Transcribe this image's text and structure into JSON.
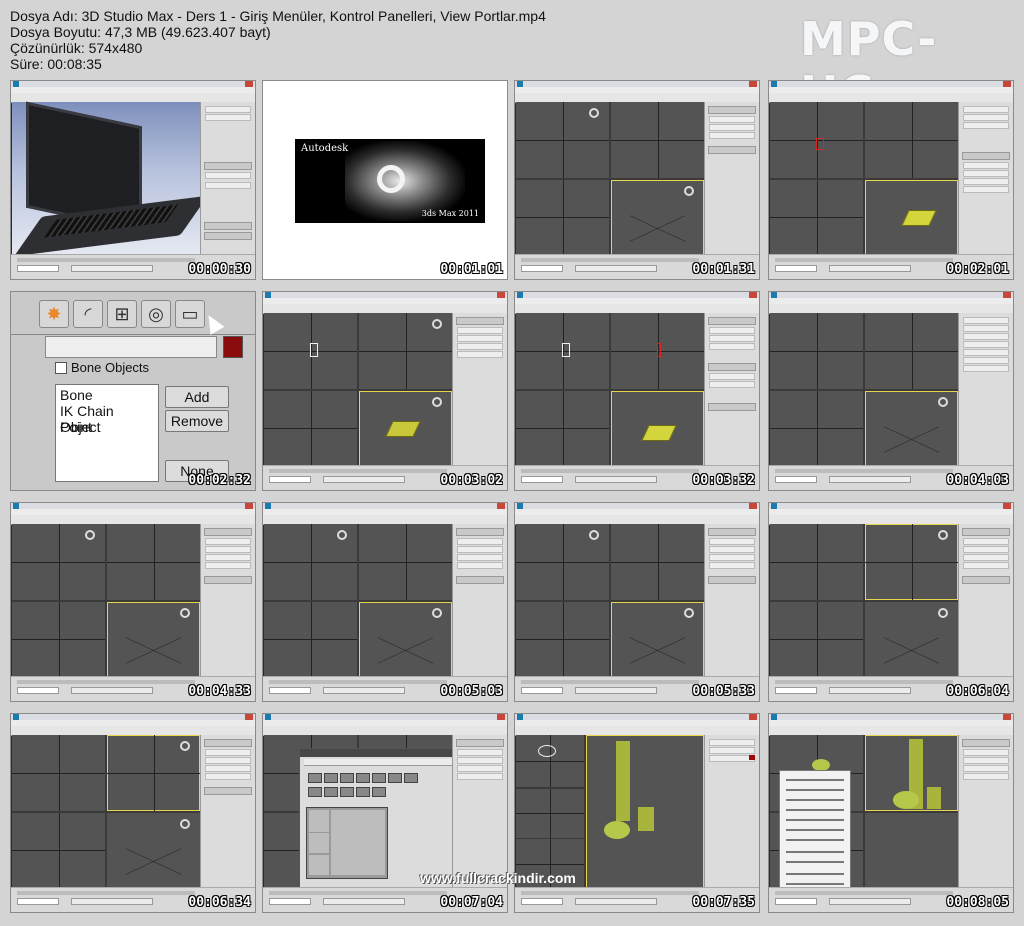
{
  "file_info": {
    "name_line": "Dosya Adı: 3D Studio Max - Ders 1 - Giriş Menüler, Kontrol Panelleri, View Portlar.mp4",
    "size_line": "Dosya Boyutu: 47,3 MB (49.623.407 bayt)",
    "resolution_line": "Çözünürlük: 574x480",
    "duration_line": "Süre: 00:08:35"
  },
  "logo_text": "MPC-HC",
  "watermark": "www.fullcrackindir.com",
  "splash": {
    "brand": "Autodesk",
    "product": "3ds Max 2011"
  },
  "zoom_panel": {
    "category_title": "Bone Objects",
    "list_items": [
      "Bone",
      "IK Chain Object",
      "Point"
    ],
    "add_button": "Add",
    "remove_button": "Remove",
    "none_button": "None",
    "tab_icons": [
      "asterisk-icon",
      "arc-icon",
      "hierarchy-icon",
      "motion-icon",
      "display-icon",
      "hammer-icon"
    ]
  },
  "colors": {
    "viewport_bg": "#545454",
    "active_border": "#e6d64b",
    "object_yellow": "#c8c83a"
  },
  "thumbnails": [
    {
      "timestamp": "00:00:30",
      "kind": "laptop"
    },
    {
      "timestamp": "00:01:01",
      "kind": "splash"
    },
    {
      "timestamp": "00:01:31",
      "kind": "viewports"
    },
    {
      "timestamp": "00:02:01",
      "kind": "viewports"
    },
    {
      "timestamp": "00:02:32",
      "kind": "zoom"
    },
    {
      "timestamp": "00:03:02",
      "kind": "viewports"
    },
    {
      "timestamp": "00:03:32",
      "kind": "viewports"
    },
    {
      "timestamp": "00:04:03",
      "kind": "viewports"
    },
    {
      "timestamp": "00:04:33",
      "kind": "viewports"
    },
    {
      "timestamp": "00:05:03",
      "kind": "viewports"
    },
    {
      "timestamp": "00:05:33",
      "kind": "viewports"
    },
    {
      "timestamp": "00:06:04",
      "kind": "viewports"
    },
    {
      "timestamp": "00:06:34",
      "kind": "viewports"
    },
    {
      "timestamp": "00:07:04",
      "kind": "dialog"
    },
    {
      "timestamp": "00:07:35",
      "kind": "teapot"
    },
    {
      "timestamp": "00:08:05",
      "kind": "menu"
    }
  ]
}
